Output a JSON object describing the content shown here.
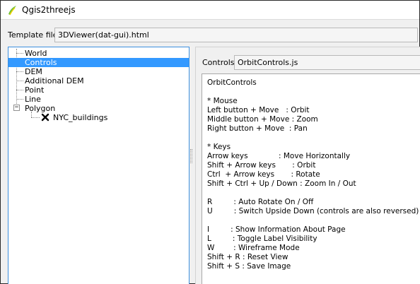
{
  "window": {
    "title": "Qgis2threejs",
    "icon": "qgis-icon"
  },
  "template": {
    "label": "Template file",
    "value": "3DViewer(dat-gui).html"
  },
  "tree": {
    "items": [
      {
        "label": "World"
      },
      {
        "label": "Controls"
      },
      {
        "label": "DEM"
      },
      {
        "label": "Additional DEM"
      },
      {
        "label": "Point"
      },
      {
        "label": "Line"
      },
      {
        "label": "Polygon",
        "expander": "−"
      },
      {
        "label": "NYC_buildings",
        "check_icon": "x-mark-icon"
      }
    ],
    "selected_index": 1
  },
  "controls": {
    "label": "Controls",
    "value": "OrbitControls.js",
    "description": [
      "OrbitControls",
      "",
      "* Mouse",
      "Left button + Move   : Orbit",
      "Middle button + Move : Zoom",
      "Right button + Move  : Pan",
      "",
      "* Keys",
      "Arrow keys             : Move Horizontally",
      "Shift + Arrow keys       : Orbit",
      "Ctrl  + Arrow keys       : Rotate",
      "Shift + Ctrl + Up / Down : Zoom In / Out",
      "",
      "R         : Auto Rotate On / Off",
      "U         : Switch Upside Down (controls are also reversed)",
      "",
      "I         : Show Information About Page",
      "L         : Toggle Label Visibility",
      "W        : Wireframe Mode",
      "Shift + R : Reset View",
      "Shift + S : Save Image"
    ]
  },
  "colors": {
    "selection": "#3399ff",
    "tree_border": "#3c8fde",
    "qgis_green": "#6cbf3a",
    "qgis_yellow": "#f1d400"
  }
}
